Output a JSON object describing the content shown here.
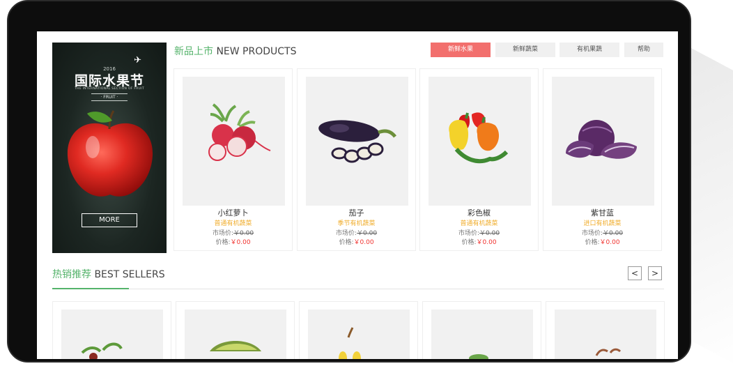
{
  "promo": {
    "year": "2016",
    "title": "国际水果节",
    "subtitle": "THE INTERNATIONAL SECTION OF FRUIT",
    "label": "· FRUIT ·",
    "more": "MORE"
  },
  "new_products": {
    "title_cn": "新品上市",
    "title_en": " NEW PRODUCTS",
    "tabs": [
      "新鲜水果",
      "新鲜蔬菜",
      "有机果蔬",
      "帮助"
    ],
    "items": [
      {
        "name": "小红萝卜",
        "desc": "普通有机蔬菜",
        "market_label": "市场价:",
        "market_price": "￥0.00",
        "price_label": "价格:",
        "price": "￥0.00"
      },
      {
        "name": "茄子",
        "desc": "季节有机蔬菜",
        "market_label": "市场价:",
        "market_price": "￥0.00",
        "price_label": "价格:",
        "price": "￥0.00"
      },
      {
        "name": "彩色椒",
        "desc": "普通有机蔬菜",
        "market_label": "市场价:",
        "market_price": "￥0.00",
        "price_label": "价格:",
        "price": "￥0.00"
      },
      {
        "name": "紫甘蓝",
        "desc": "进口有机蔬菜",
        "market_label": "市场价:",
        "market_price": "￥0.00",
        "price_label": "价格:",
        "price": "￥0.00"
      }
    ]
  },
  "best_sellers": {
    "title_cn": "热销推荐",
    "title_en": " BEST SELLERS",
    "prev": "<",
    "next": ">"
  },
  "colors": {
    "accent_green": "#55b36b",
    "active_tab": "#f26f6d",
    "desc_orange": "#f0ad2c",
    "price_red": "#f0322e"
  }
}
